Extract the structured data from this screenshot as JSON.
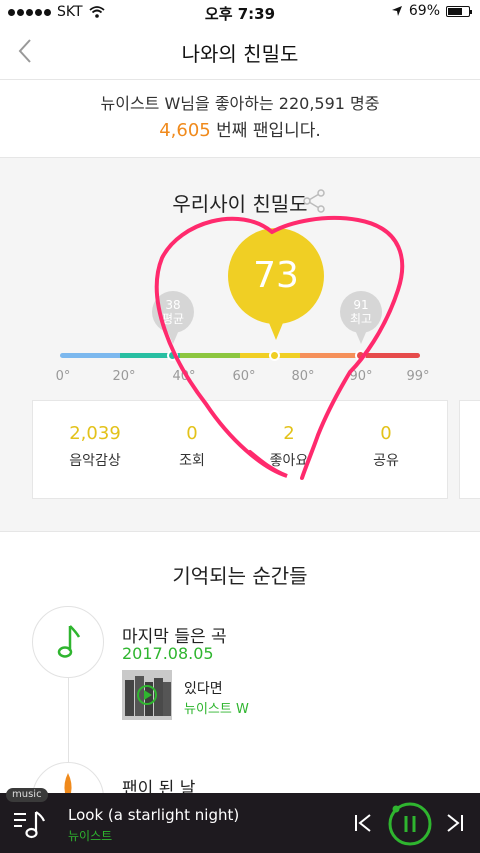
{
  "status_bar": {
    "carrier": "SKT",
    "time": "오후 7:39",
    "battery": "69%"
  },
  "nav": {
    "title": "나와의 친밀도"
  },
  "fan": {
    "line1": "뉴이스트 W님을 좋아하는 220,591 명중",
    "rank": "4,605",
    "line2_suffix": " 번째 팬입니다."
  },
  "intimacy": {
    "title": "우리사이 친밀도",
    "score": "73",
    "average": {
      "value": "38",
      "label": "평균"
    },
    "highest": {
      "value": "91",
      "label": "최고"
    },
    "ticks": [
      "0°",
      "20°",
      "40°",
      "60°",
      "80°",
      "90°",
      "99°"
    ],
    "scale_colors": [
      "#7cb8ee",
      "#28bfa2",
      "#8cc63f",
      "#f0cf24",
      "#f5905a",
      "#e64b4b"
    ],
    "stats": [
      {
        "value": "2,039",
        "label": "음악감상"
      },
      {
        "value": "0",
        "label": "조회"
      },
      {
        "value": "2",
        "label": "좋아요"
      },
      {
        "value": "0",
        "label": "공유"
      }
    ]
  },
  "moments": {
    "title": "기억되는 순간들",
    "item1": {
      "title": "마지막 들은 곡",
      "date": "2017.08.05",
      "song": "있다면",
      "artist": "뉴이스트 W"
    },
    "item2": {
      "title": "팬이 된 날"
    }
  },
  "player": {
    "tag": "music",
    "title": "Look (a starlight night)",
    "artist": "뉴이스트"
  },
  "colors": {
    "accent_green": "#2fb52f",
    "accent_orange": "#f08a1c",
    "score_yellow": "#f0cf24",
    "annotation_pink": "#ff2a6d"
  }
}
